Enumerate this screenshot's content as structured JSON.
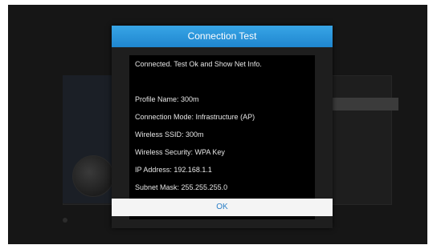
{
  "dialog": {
    "title": "Connection Test",
    "status": "Connected. Test Ok and Show Net Info.",
    "details": [
      "Profile Name: 300m",
      "Connection Mode: Infrastructure (AP)",
      "Wireless SSID: 300m",
      "Wireless Security: WPA Key",
      "IP Address: 192.168.1.1",
      "Subnet Mask: 255.255.255.0"
    ],
    "ok_label": "OK"
  },
  "colors": {
    "header": "#2896dc",
    "ok_text": "#2a7fc7",
    "body_bg": "#000000"
  }
}
